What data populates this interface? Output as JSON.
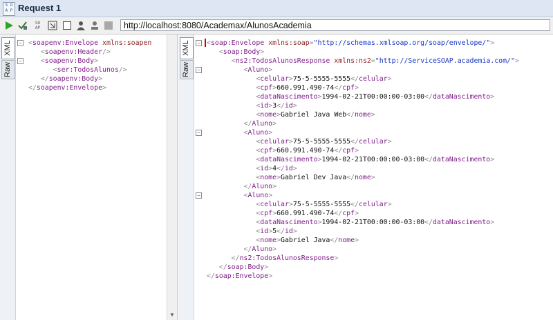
{
  "window": {
    "title": "Request 1",
    "badge_top": "S O",
    "badge_bottom": "A P"
  },
  "toolbar": {
    "icons": [
      "run-icon",
      "validate-icon",
      "soap-header-icon",
      "expand-icon",
      "window-icon",
      "user-icon",
      "stop-icon"
    ],
    "endpoint_url": "http://localhost:8080/Academax/AlunosAcademia"
  },
  "request_pane": {
    "tabs": [
      "XML",
      "Raw"
    ],
    "active_tab": "XML",
    "lines": [
      [
        [
          "punct",
          "<"
        ],
        [
          "tag",
          "soapenv:Envelope"
        ],
        [
          "punct",
          " "
        ],
        [
          "attr",
          "xmlns:soapen"
        ]
      ],
      [
        [
          "punct",
          "   <"
        ],
        [
          "tag",
          "soapenv:Header"
        ],
        [
          "punct",
          "/>"
        ]
      ],
      [
        [
          "punct",
          "   <"
        ],
        [
          "tag",
          "soapenv:Body"
        ],
        [
          "punct",
          ">"
        ]
      ],
      [
        [
          "punct",
          "      <"
        ],
        [
          "tag",
          "ser:TodosAlunos"
        ],
        [
          "punct",
          "/>"
        ]
      ],
      [
        [
          "punct",
          "   </"
        ],
        [
          "tag",
          "soapenv:Body"
        ],
        [
          "punct",
          ">"
        ]
      ],
      [
        [
          "punct",
          "</"
        ],
        [
          "tag",
          "soapenv:Envelope"
        ],
        [
          "punct",
          ">"
        ]
      ]
    ],
    "fold_lines": [
      0,
      2
    ]
  },
  "response_pane": {
    "tabs": [
      "XML",
      "Raw"
    ],
    "active_tab": "XML",
    "lines": [
      [
        [
          "punct",
          "<"
        ],
        [
          "tag",
          "soap:Envelope"
        ],
        [
          "punct",
          " "
        ],
        [
          "attr",
          "xmlns:soap"
        ],
        [
          "punct",
          "="
        ],
        [
          "val",
          "\"http://schemas.xmlsoap.org/soap/envelope/\""
        ],
        [
          "punct",
          ">"
        ]
      ],
      [
        [
          "punct",
          "   <"
        ],
        [
          "tag",
          "soap:Body"
        ],
        [
          "punct",
          ">"
        ]
      ],
      [
        [
          "punct",
          "      <"
        ],
        [
          "tag",
          "ns2:TodosAlunosResponse"
        ],
        [
          "punct",
          " "
        ],
        [
          "attr",
          "xmlns:ns2"
        ],
        [
          "punct",
          "="
        ],
        [
          "val",
          "\"http://ServiceSOAP.academia.com/\""
        ],
        [
          "punct",
          ">"
        ]
      ],
      [
        [
          "punct",
          "         <"
        ],
        [
          "tag",
          "Aluno"
        ],
        [
          "punct",
          ">"
        ]
      ],
      [
        [
          "punct",
          "            <"
        ],
        [
          "tag",
          "celular"
        ],
        [
          "punct",
          ">"
        ],
        [
          "txt",
          "75-5-5555-5555"
        ],
        [
          "punct",
          "</"
        ],
        [
          "tag",
          "celular"
        ],
        [
          "punct",
          ">"
        ]
      ],
      [
        [
          "punct",
          "            <"
        ],
        [
          "tag",
          "cpf"
        ],
        [
          "punct",
          ">"
        ],
        [
          "txt",
          "660.991.490-74"
        ],
        [
          "punct",
          "</"
        ],
        [
          "tag",
          "cpf"
        ],
        [
          "punct",
          ">"
        ]
      ],
      [
        [
          "punct",
          "            <"
        ],
        [
          "tag",
          "dataNascimento"
        ],
        [
          "punct",
          ">"
        ],
        [
          "txt",
          "1994-02-21T00:00:00-03:00"
        ],
        [
          "punct",
          "</"
        ],
        [
          "tag",
          "dataNascimento"
        ],
        [
          "punct",
          ">"
        ]
      ],
      [
        [
          "punct",
          "            <"
        ],
        [
          "tag",
          "id"
        ],
        [
          "punct",
          ">"
        ],
        [
          "txt",
          "3"
        ],
        [
          "punct",
          "</"
        ],
        [
          "tag",
          "id"
        ],
        [
          "punct",
          ">"
        ]
      ],
      [
        [
          "punct",
          "            <"
        ],
        [
          "tag",
          "nome"
        ],
        [
          "punct",
          ">"
        ],
        [
          "txt",
          "Gabriel Java Web"
        ],
        [
          "punct",
          "</"
        ],
        [
          "tag",
          "nome"
        ],
        [
          "punct",
          ">"
        ]
      ],
      [
        [
          "punct",
          "         </"
        ],
        [
          "tag",
          "Aluno"
        ],
        [
          "punct",
          ">"
        ]
      ],
      [
        [
          "punct",
          "         <"
        ],
        [
          "tag",
          "Aluno"
        ],
        [
          "punct",
          ">"
        ]
      ],
      [
        [
          "punct",
          "            <"
        ],
        [
          "tag",
          "celular"
        ],
        [
          "punct",
          ">"
        ],
        [
          "txt",
          "75-5-5555-5555"
        ],
        [
          "punct",
          "</"
        ],
        [
          "tag",
          "celular"
        ],
        [
          "punct",
          ">"
        ]
      ],
      [
        [
          "punct",
          "            <"
        ],
        [
          "tag",
          "cpf"
        ],
        [
          "punct",
          ">"
        ],
        [
          "txt",
          "660.991.490-74"
        ],
        [
          "punct",
          "</"
        ],
        [
          "tag",
          "cpf"
        ],
        [
          "punct",
          ">"
        ]
      ],
      [
        [
          "punct",
          "            <"
        ],
        [
          "tag",
          "dataNascimento"
        ],
        [
          "punct",
          ">"
        ],
        [
          "txt",
          "1994-02-21T00:00:00-03:00"
        ],
        [
          "punct",
          "</"
        ],
        [
          "tag",
          "dataNascimento"
        ],
        [
          "punct",
          ">"
        ]
      ],
      [
        [
          "punct",
          "            <"
        ],
        [
          "tag",
          "id"
        ],
        [
          "punct",
          ">"
        ],
        [
          "txt",
          "4"
        ],
        [
          "punct",
          "</"
        ],
        [
          "tag",
          "id"
        ],
        [
          "punct",
          ">"
        ]
      ],
      [
        [
          "punct",
          "            <"
        ],
        [
          "tag",
          "nome"
        ],
        [
          "punct",
          ">"
        ],
        [
          "txt",
          "Gabriel Dev Java"
        ],
        [
          "punct",
          "</"
        ],
        [
          "tag",
          "nome"
        ],
        [
          "punct",
          ">"
        ]
      ],
      [
        [
          "punct",
          "         </"
        ],
        [
          "tag",
          "Aluno"
        ],
        [
          "punct",
          ">"
        ]
      ],
      [
        [
          "punct",
          "         <"
        ],
        [
          "tag",
          "Aluno"
        ],
        [
          "punct",
          ">"
        ]
      ],
      [
        [
          "punct",
          "            <"
        ],
        [
          "tag",
          "celular"
        ],
        [
          "punct",
          ">"
        ],
        [
          "txt",
          "75-5-5555-5555"
        ],
        [
          "punct",
          "</"
        ],
        [
          "tag",
          "celular"
        ],
        [
          "punct",
          ">"
        ]
      ],
      [
        [
          "punct",
          "            <"
        ],
        [
          "tag",
          "cpf"
        ],
        [
          "punct",
          ">"
        ],
        [
          "txt",
          "660.991.490-74"
        ],
        [
          "punct",
          "</"
        ],
        [
          "tag",
          "cpf"
        ],
        [
          "punct",
          ">"
        ]
      ],
      [
        [
          "punct",
          "            <"
        ],
        [
          "tag",
          "dataNascimento"
        ],
        [
          "punct",
          ">"
        ],
        [
          "txt",
          "1994-02-21T00:00:00-03:00"
        ],
        [
          "punct",
          "</"
        ],
        [
          "tag",
          "dataNascimento"
        ],
        [
          "punct",
          ">"
        ]
      ],
      [
        [
          "punct",
          "            <"
        ],
        [
          "tag",
          "id"
        ],
        [
          "punct",
          ">"
        ],
        [
          "txt",
          "5"
        ],
        [
          "punct",
          "</"
        ],
        [
          "tag",
          "id"
        ],
        [
          "punct",
          ">"
        ]
      ],
      [
        [
          "punct",
          "            <"
        ],
        [
          "tag",
          "nome"
        ],
        [
          "punct",
          ">"
        ],
        [
          "txt",
          "Gabriel Java"
        ],
        [
          "punct",
          "</"
        ],
        [
          "tag",
          "nome"
        ],
        [
          "punct",
          ">"
        ]
      ],
      [
        [
          "punct",
          "         </"
        ],
        [
          "tag",
          "Aluno"
        ],
        [
          "punct",
          ">"
        ]
      ],
      [
        [
          "punct",
          "      </"
        ],
        [
          "tag",
          "ns2:TodosAlunosResponse"
        ],
        [
          "punct",
          ">"
        ]
      ],
      [
        [
          "punct",
          "   </"
        ],
        [
          "tag",
          "soap:Body"
        ],
        [
          "punct",
          ">"
        ]
      ],
      [
        [
          "punct",
          "</"
        ],
        [
          "tag",
          "soap:Envelope"
        ],
        [
          "punct",
          ">"
        ]
      ]
    ],
    "fold_lines": [
      0,
      3,
      10,
      17
    ]
  },
  "colors": {
    "tag": "#7f1d8a",
    "attr": "#8a1f1f",
    "value": "#1534c6",
    "text": "#111111",
    "run_green": "#2aa52a"
  }
}
